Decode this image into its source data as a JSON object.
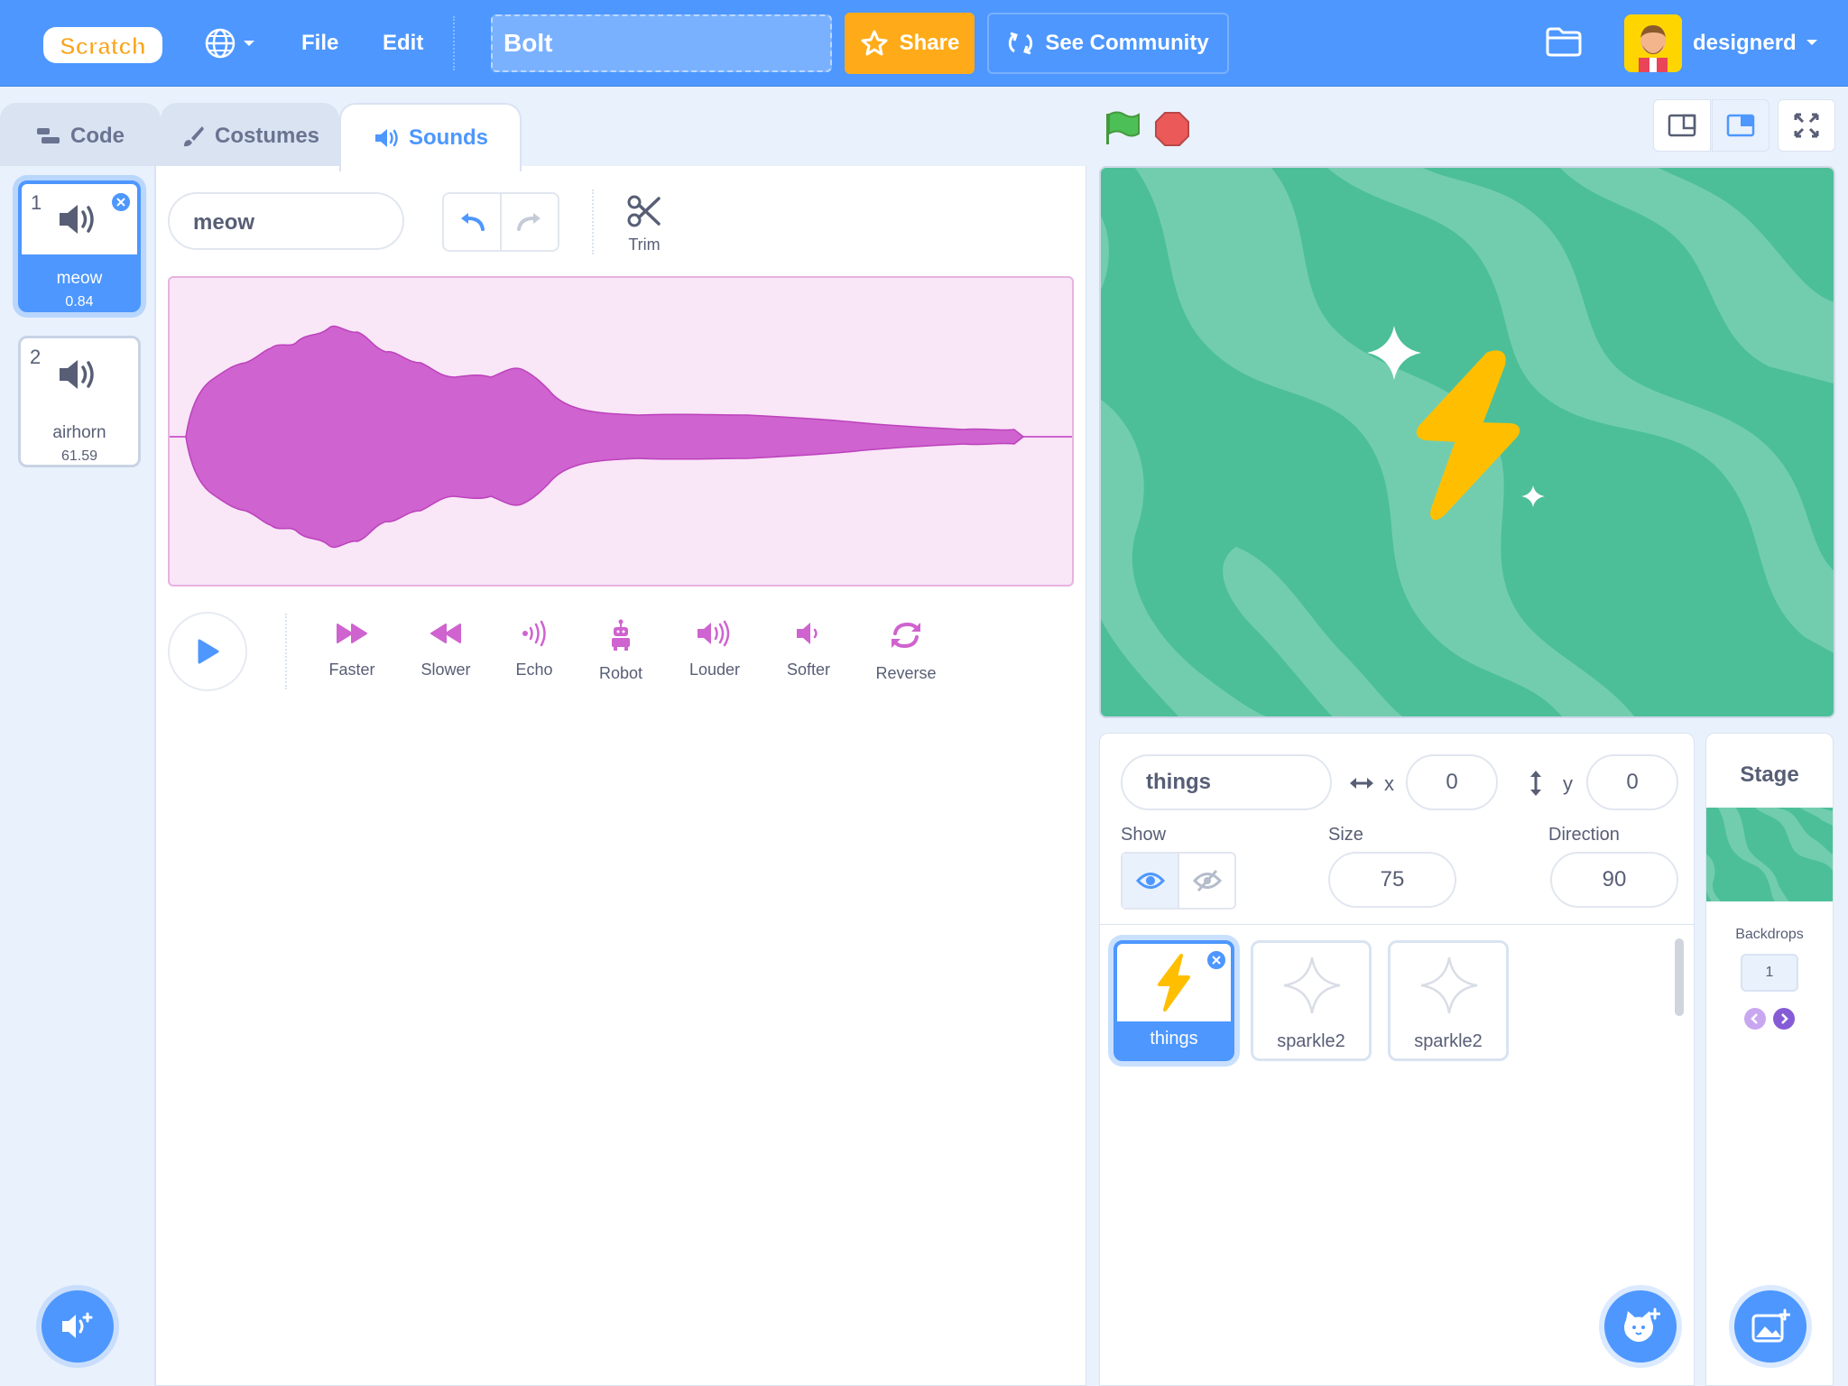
{
  "menubar": {
    "logo_text": "Scratch",
    "file_label": "File",
    "edit_label": "Edit",
    "project_title": "Bolt",
    "share_label": "Share",
    "community_label": "See Community",
    "username": "designerd"
  },
  "tabs": [
    {
      "label": "Code"
    },
    {
      "label": "Costumes"
    },
    {
      "label": "Sounds"
    }
  ],
  "sounds": [
    {
      "number": "1",
      "name": "meow",
      "duration": "0.84"
    },
    {
      "number": "2",
      "name": "airhorn",
      "duration": "61.59"
    }
  ],
  "editor": {
    "sound_name": "meow",
    "trim_label": "Trim",
    "effects": [
      {
        "label": "Faster"
      },
      {
        "label": "Slower"
      },
      {
        "label": "Echo"
      },
      {
        "label": "Robot"
      },
      {
        "label": "Louder"
      },
      {
        "label": "Softer"
      },
      {
        "label": "Reverse"
      }
    ]
  },
  "sprite_info": {
    "sprite_name": "things",
    "x_label": "x",
    "x_value": "0",
    "y_label": "y",
    "y_value": "0",
    "show_label": "Show",
    "size_label": "Size",
    "size_value": "75",
    "direction_label": "Direction",
    "direction_value": "90"
  },
  "sprites": [
    {
      "name": "things"
    },
    {
      "name": "sparkle2"
    },
    {
      "name": "sparkle2"
    }
  ],
  "stage_panel": {
    "title": "Stage",
    "backdrops_label": "Backdrops",
    "backdrops_count": "1"
  },
  "colors": {
    "accent": "#4d97ff",
    "share": "#ffab19",
    "sound": "#cf63cf",
    "stage_bg": "#4cbf99"
  }
}
